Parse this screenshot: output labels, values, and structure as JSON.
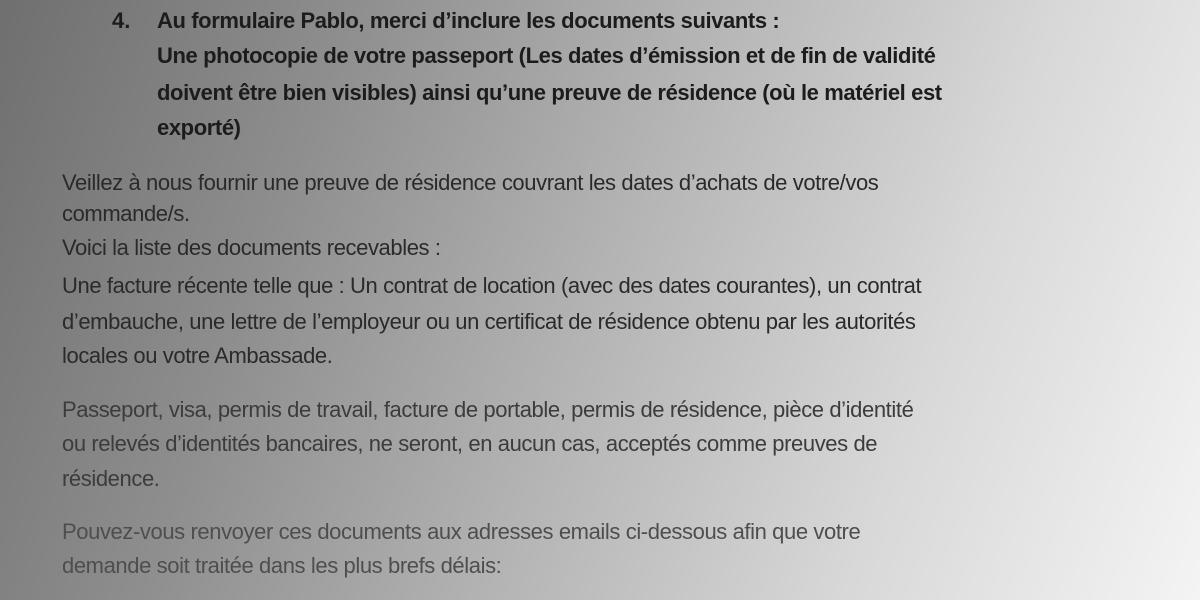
{
  "item": {
    "number": "4.",
    "lines": [
      "Au formulaire Pablo, merci d’inclure les documents suivants :",
      "Une photocopie de votre passeport (Les dates d’émission et de fin de validité",
      "doivent être bien visibles) ainsi qu’une preuve de résidence (où le matériel est",
      "exporté)"
    ]
  },
  "paragraph1": [
    "Veillez à nous fournir une preuve de résidence couvrant les dates d’achats de votre/vos",
    "commande/s.",
    "Voici la liste des documents recevables :",
    "Une facture récente telle que : Un contrat de location (avec des dates courantes), un contrat",
    "d’embauche, une lettre de l’employeur ou un certificat de résidence obtenu par les autorités",
    "locales ou votre Ambassade."
  ],
  "paragraph2": [
    "Passeport, visa, permis de travail, facture de portable, permis de résidence, pièce d’identité",
    "ou relevés d’identités bancaires, ne seront, en aucun cas, acceptés comme preuves de",
    "résidence."
  ],
  "paragraph3": [
    "Pouvez-vous renvoyer ces documents aux adresses emails ci-dessous afin que votre",
    "demande soit traitée dans les plus brefs délais:"
  ]
}
